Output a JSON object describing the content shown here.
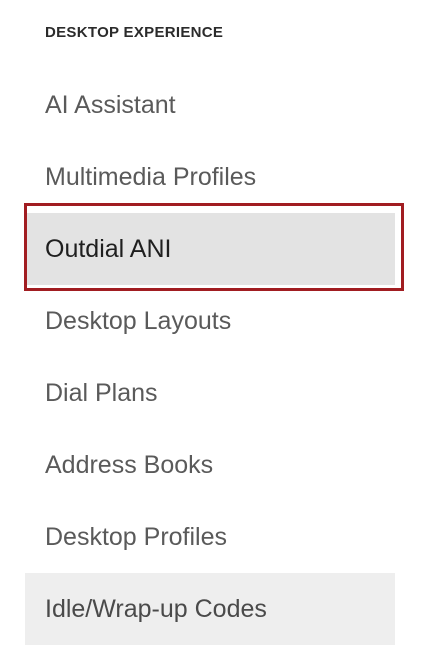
{
  "section": {
    "title": "DESKTOP EXPERIENCE"
  },
  "nav": {
    "items": [
      {
        "label": "AI Assistant",
        "state": "normal"
      },
      {
        "label": "Multimedia Profiles",
        "state": "normal"
      },
      {
        "label": "Outdial ANI",
        "state": "selected"
      },
      {
        "label": "Desktop Layouts",
        "state": "normal"
      },
      {
        "label": "Dial Plans",
        "state": "normal"
      },
      {
        "label": "Address Books",
        "state": "normal"
      },
      {
        "label": "Desktop Profiles",
        "state": "normal"
      },
      {
        "label": "Idle/Wrap-up Codes",
        "state": "hovered"
      }
    ]
  },
  "colors": {
    "selected_bg": "#e3e3e3",
    "hover_bg": "#eeeeee",
    "highlight_border": "#a11d21",
    "text": "#5a5a5a"
  }
}
